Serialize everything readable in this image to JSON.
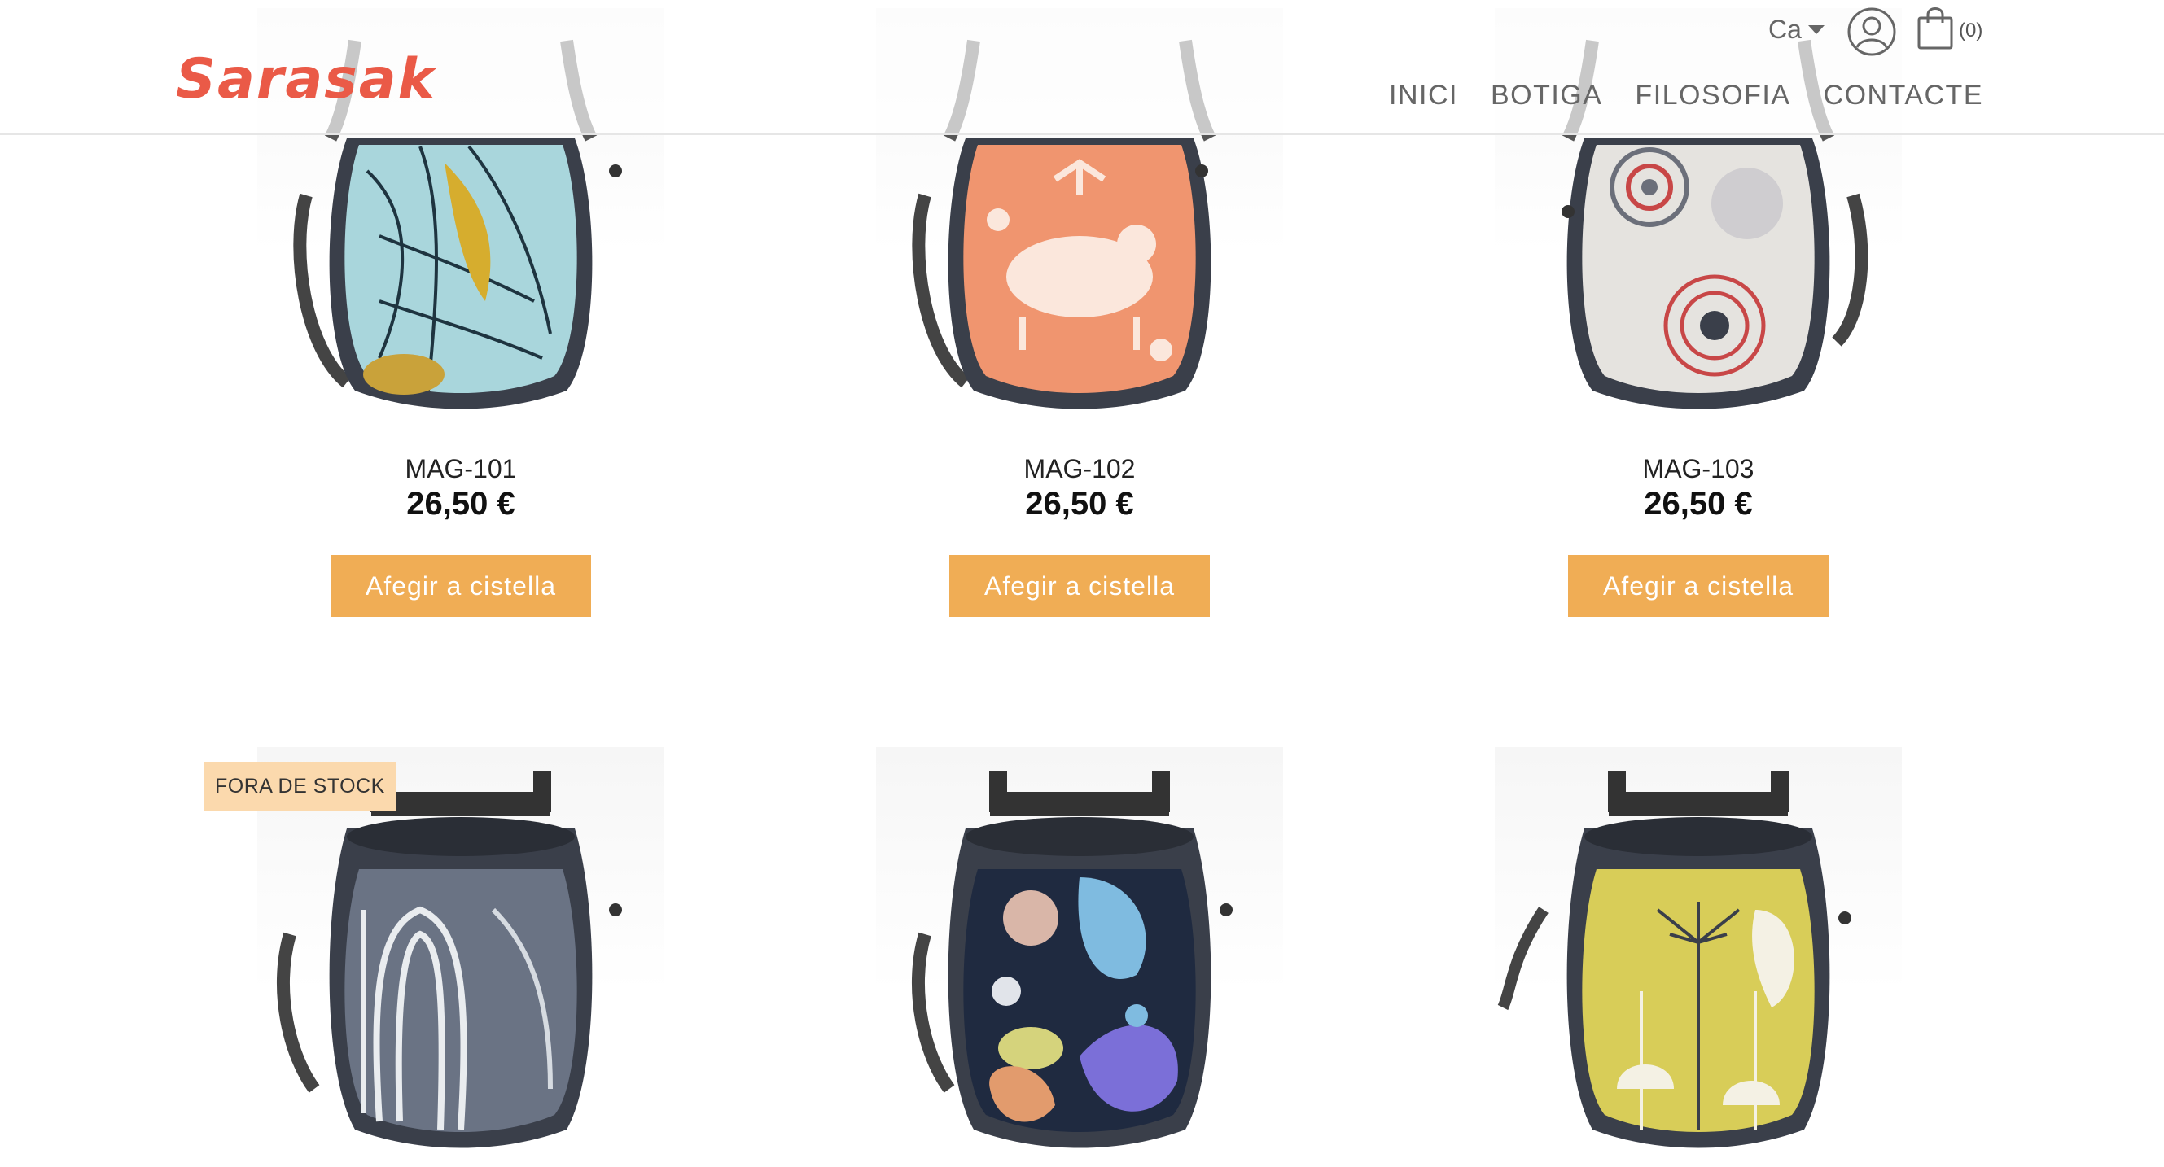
{
  "header": {
    "logo": "Sarasak",
    "language": "Ca",
    "cart_count": "(0)",
    "nav": [
      "INICI",
      "BOTIGA",
      "FILOSOFIA",
      "CONTACTE"
    ]
  },
  "products": [
    {
      "name": "MAG-101",
      "price": "26,50 €",
      "button": "Afegir a cistella"
    },
    {
      "name": "MAG-102",
      "price": "26,50 €",
      "button": "Afegir a cistella"
    },
    {
      "name": "MAG-103",
      "price": "26,50 €",
      "button": "Afegir a cistella"
    },
    {
      "name": "",
      "price": "",
      "badge": "FORA DE STOCK"
    },
    {
      "name": "",
      "price": ""
    },
    {
      "name": "",
      "price": ""
    }
  ],
  "colors": {
    "logo": "#ea5a47",
    "button": "#f0ad55",
    "badge": "#fbd9ad"
  }
}
